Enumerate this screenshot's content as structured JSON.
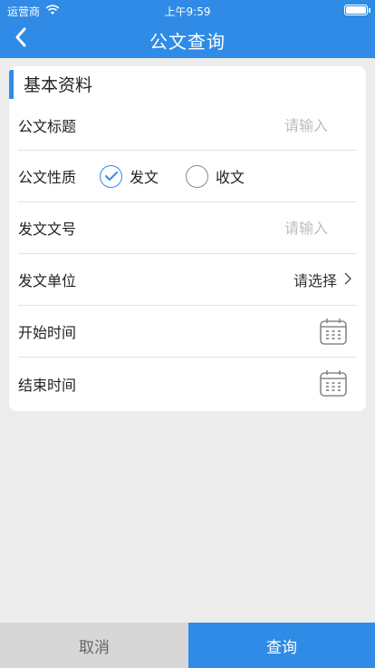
{
  "status_bar": {
    "carrier": "运营商",
    "time": "上午9:59",
    "wifi_icon": "wifi-icon",
    "battery_icon": "battery-icon"
  },
  "nav": {
    "title": "公文查询",
    "back_icon": "chevron-left-icon"
  },
  "section": {
    "title": "基本资料"
  },
  "form": {
    "title_label": "公文标题",
    "title_placeholder": "请输入",
    "nature_label": "公文性质",
    "nature_options": [
      "发文",
      "收文"
    ],
    "nature_selected": "发文",
    "doc_no_label": "发文文号",
    "doc_no_placeholder": "请输入",
    "unit_label": "发文单位",
    "unit_value": "请选择",
    "start_label": "开始时间",
    "end_label": "结束时间",
    "calendar_icon": "calendar-icon"
  },
  "footer": {
    "cancel": "取消",
    "query": "查询"
  },
  "colors": {
    "primary": "#2f8be6",
    "background": "#ececec",
    "cancel_bg": "#d7d7d7"
  }
}
